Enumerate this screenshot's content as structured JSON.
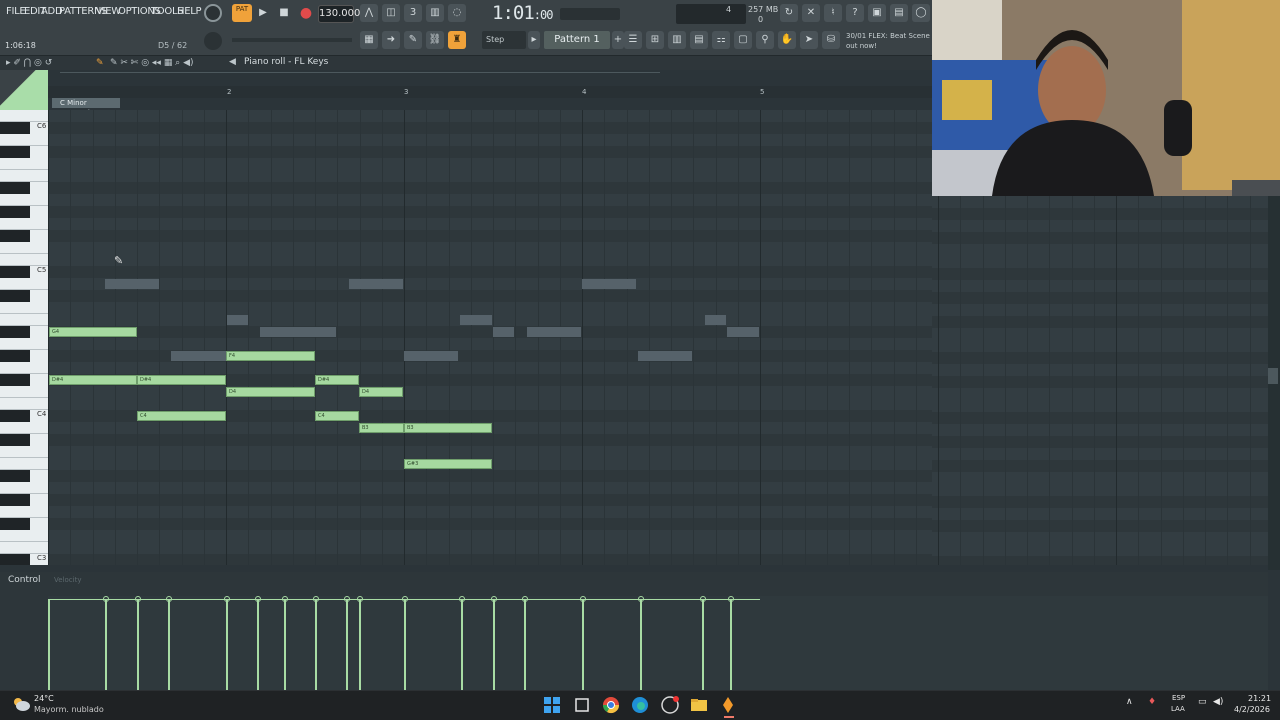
{
  "menu": [
    "FILE",
    "EDIT",
    "ADD",
    "PATTERNS",
    "VIEW",
    "OPTIONS",
    "TOOLS",
    "HELP"
  ],
  "transport": {
    "pat_label": "PAT",
    "song_label": "SONG",
    "tempo": "130.000",
    "time": "1:01",
    "time_sub": ":00",
    "time_top": "B:S:T"
  },
  "monitor": {
    "mem": "257 MB",
    "cpu": "0",
    "poly": "4"
  },
  "hint": {
    "left": "1:06:18",
    "right": "D5 / 62"
  },
  "toolbar": {
    "step": "Step",
    "pattern": "Pattern 1",
    "news_line1": "30/01  FLEX: Beat Scene",
    "news_line2": "out now!"
  },
  "piano_roll": {
    "title": "Piano roll - FL Keys",
    "scale": "C Minor Harmonic",
    "bar_numbers": [
      "2",
      "3",
      "4",
      "5"
    ],
    "octave_labels": [
      "C6",
      "C5",
      "C4",
      "C3"
    ],
    "notes": [
      "G4",
      "D#4",
      "D#4",
      "F4",
      "D4",
      "C4",
      "D#4",
      "C4",
      "D4",
      "B3",
      "B3",
      "G#3"
    ]
  },
  "velocity": {
    "control_label": "Control",
    "param_label": "Velocity"
  },
  "taskbar": {
    "temp": "24°C",
    "weather": "Mayorm. nublado",
    "lang1": "ESP",
    "lang2": "LAA",
    "time": "21:21",
    "date": "4/2/2026"
  },
  "colors": {
    "note": "#a6d9a0",
    "grid": "#333d42",
    "accent": "#f0a23a"
  }
}
